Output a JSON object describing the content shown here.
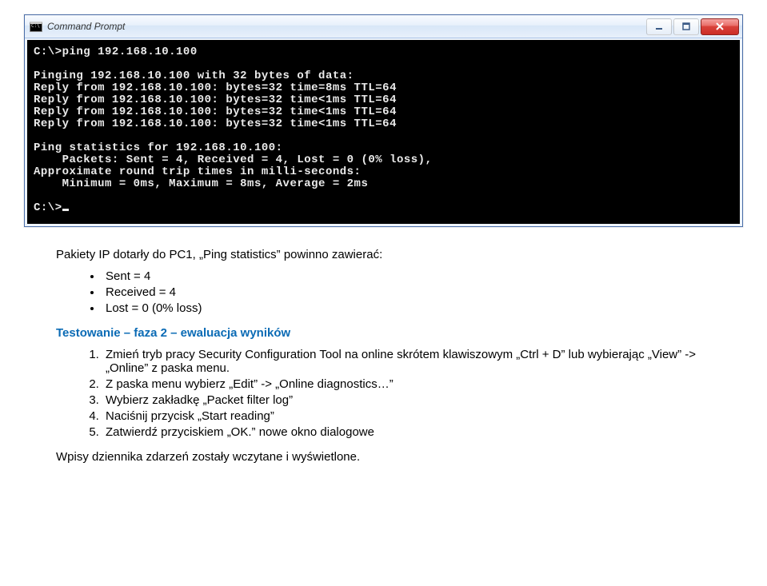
{
  "window": {
    "title": "Command Prompt"
  },
  "terminal": {
    "lines": [
      "C:\\>ping 192.168.10.100",
      "",
      "Pinging 192.168.10.100 with 32 bytes of data:",
      "Reply from 192.168.10.100: bytes=32 time=8ms TTL=64",
      "Reply from 192.168.10.100: bytes=32 time<1ms TTL=64",
      "Reply from 192.168.10.100: bytes=32 time<1ms TTL=64",
      "Reply from 192.168.10.100: bytes=32 time<1ms TTL=64",
      "",
      "Ping statistics for 192.168.10.100:",
      "    Packets: Sent = 4, Received = 4, Lost = 0 (0% loss),",
      "Approximate round trip times in milli-seconds:",
      "    Minimum = 0ms, Maximum = 8ms, Average = 2ms",
      "",
      "C:\\>"
    ]
  },
  "doc": {
    "intro": "Pakiety IP dotarły do PC1, „Ping statistics” powinno zawierać:",
    "bullets": [
      "Sent = 4",
      "Received = 4",
      "Lost = 0 (0% loss)"
    ],
    "heading": "Testowanie – faza 2 – ewaluacja wyników",
    "steps": [
      "Zmień tryb pracy Security Configuration Tool na online skrótem klawiszowym „Ctrl + D” lub wybierając „View” -> „Online” z paska menu.",
      "Z paska menu wybierz „Edit” -> „Online diagnostics…”",
      "Wybierz zakładkę „Packet filter log”",
      "Naciśnij przycisk „Start reading”",
      "Zatwierdź przyciskiem „OK.” nowe okno dialogowe"
    ],
    "outro": "Wpisy dziennika zdarzeń zostały wczytane i wyświetlone."
  }
}
